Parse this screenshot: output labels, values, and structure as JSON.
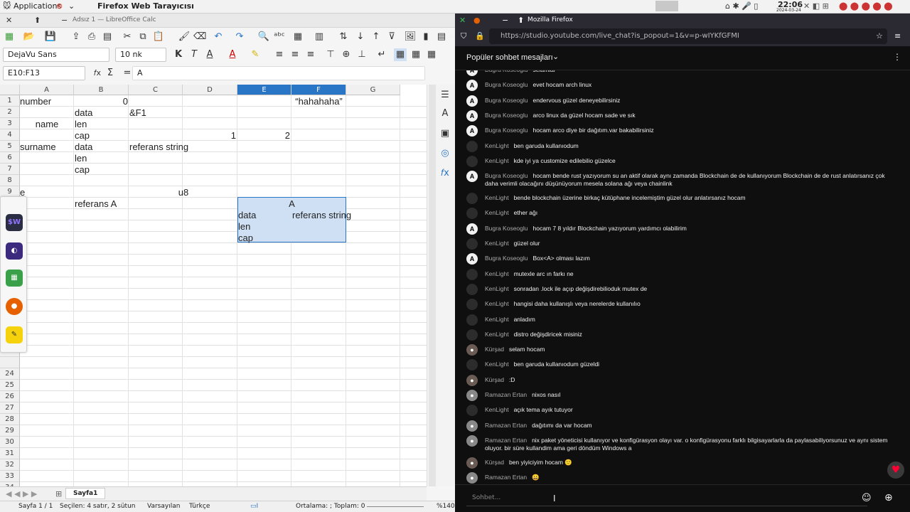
{
  "topbar": {
    "applications": "Applications",
    "window_title": "Firefox Web Tarayıcısı",
    "clock": "22:06",
    "date": "2024-03-24"
  },
  "calc": {
    "title": "Adsız 1 — LibreOffice Calc",
    "font_name": "DejaVu Sans",
    "font_size": "10 nk",
    "cell_ref": "E10:F13",
    "formula": "A",
    "columns": [
      "A",
      "B",
      "C",
      "D",
      "E",
      "F",
      "G"
    ],
    "rows": [
      "1",
      "2",
      "3",
      "4",
      "5",
      "6",
      "7",
      "8",
      "9",
      "",
      "",
      "",
      "",
      "",
      "",
      "",
      "",
      "",
      "",
      "",
      "",
      "",
      "",
      "",
      "24",
      "25",
      "26",
      "27",
      "28",
      "29",
      "30",
      "31",
      "32",
      "33",
      "34"
    ],
    "cells": {
      "A1": "number",
      "B1": "0",
      "F1": "“hahahaha”",
      "B2": "data",
      "C2": "&F1",
      "A3": "name",
      "B3": "len",
      "B4": "cap",
      "D4": "1",
      "E4": "2",
      "A5": "surname",
      "B5": "data",
      "C5": "referans string",
      "B6": "len",
      "B7": "cap",
      "A9": "e",
      "C9": "u8",
      "B10": "referans A",
      "E10": "A",
      "E11": "data",
      "F11": "referans string",
      "E12": "len",
      "E13": "cap"
    },
    "sheet_tab": "Sayfa1",
    "status": {
      "page": "Sayfa 1 / 1",
      "selection": "Seçilen: 4 satır, 2 sütun",
      "style": "Varsayılan",
      "lang": "Türkçe",
      "sum": "Ortalama: ; Toplam: 0",
      "zoom": "%140"
    }
  },
  "dock": {
    "items": [
      "$W",
      "kdeconnect",
      "calc",
      "firefox",
      "notes"
    ]
  },
  "firefox": {
    "title": "Mozilla Firefox",
    "url": "https://studio.youtube.com/live_chat?is_popout=1&v=p-wIYKfGFMI",
    "chat_header": "Popüler sohbet mesajları",
    "input_placeholder": "Sohbet...",
    "messages": [
      {
        "author": "Bugra Koseoglu",
        "text": "selamlar",
        "av": "a"
      },
      {
        "author": "Bugra Koseoglu",
        "text": "evet hocam arch linux",
        "av": "a"
      },
      {
        "author": "Bugra Koseoglu",
        "text": "endervous güzel deneyebilirsiniz",
        "av": "a"
      },
      {
        "author": "Bugra Koseoglu",
        "text": "arco linux da güzel hocam sade ve sık",
        "av": "a"
      },
      {
        "author": "Bugra Koseoglu",
        "text": "hocam arco diye bir dağıtım.var bakabilirsiniz",
        "av": "a"
      },
      {
        "author": "KenLight",
        "text": "ben garuda kullanıodum",
        "av": "k"
      },
      {
        "author": "KenLight",
        "text": "kde iyi ya customize edilebilio güzelce",
        "av": "k"
      },
      {
        "author": "Bugra Koseoglu",
        "text": "hocam bende rust yazıyorum su an aktif olarak aynı zamanda Blockchain de de kullanıyorum Blockchain de de rust anlatırsanız çok daha verimli olacağını düşünüyorum mesela solana ağı veya chainlink",
        "av": "a"
      },
      {
        "author": "KenLight",
        "text": "bende blockchain üzerine birkaç kütüphane incelemiştim güzel olur anlatırsanız hocam",
        "av": "k"
      },
      {
        "author": "KenLight",
        "text": "ether ağı",
        "av": "k"
      },
      {
        "author": "Bugra Koseoglu",
        "text": "hocam 7 8 yıldır Blockchain yazıyorum yardımcı olabilirim",
        "av": "a"
      },
      {
        "author": "KenLight",
        "text": "güzel olur",
        "av": "k"
      },
      {
        "author": "Bugra Koseoglu",
        "text": "Box<A> olması lazım",
        "av": "a"
      },
      {
        "author": "KenLight",
        "text": "mutexle arc ın farkı ne",
        "av": "k"
      },
      {
        "author": "KenLight",
        "text": "sonradan .lock ile açıp değişdirebilioduk mutex de",
        "av": "k"
      },
      {
        "author": "KenLight",
        "text": "hangisi daha kullanışlı veya nerelerde kullanılıo",
        "av": "k"
      },
      {
        "author": "KenLight",
        "text": "anladım",
        "av": "k"
      },
      {
        "author": "KenLight",
        "text": "distro değişdiricek misiniz",
        "av": "k"
      },
      {
        "author": "Kürşad",
        "text": "selam hocam",
        "av": "u"
      },
      {
        "author": "KenLight",
        "text": "ben garuda kullanıodum güzeldi",
        "av": "k"
      },
      {
        "author": "Kürşad",
        "text": ":D",
        "av": "u"
      },
      {
        "author": "Ramazan Ertan",
        "text": "nixos nasıl",
        "av": "r"
      },
      {
        "author": "KenLight",
        "text": "açık tema ayık tutuyor",
        "av": "k"
      },
      {
        "author": "Ramazan Ertan",
        "text": "dağıtımı da var hocam",
        "av": "r"
      },
      {
        "author": "Ramazan Ertan",
        "text": "nix paket yöneticisi kullanıyor ve konfigürasyon olayı var. o konfigürasyonu farklı bilgisayarlarla da paylasabiliyorsunuz ve aynı sistem oluyor. bir süre kullandim ama geri döndüm Windows a",
        "av": "r"
      },
      {
        "author": "Kürşad",
        "text": "ben yiyiciyim hocam 🙂",
        "av": "u"
      },
      {
        "author": "Ramazan Ertan",
        "text": "😀",
        "av": "r"
      }
    ]
  },
  "colors": {
    "calc_accent": "#2a76c6",
    "yt_bg": "#0f0f0f",
    "ff_bar": "#2b2a33",
    "heart": "#ff0033"
  }
}
